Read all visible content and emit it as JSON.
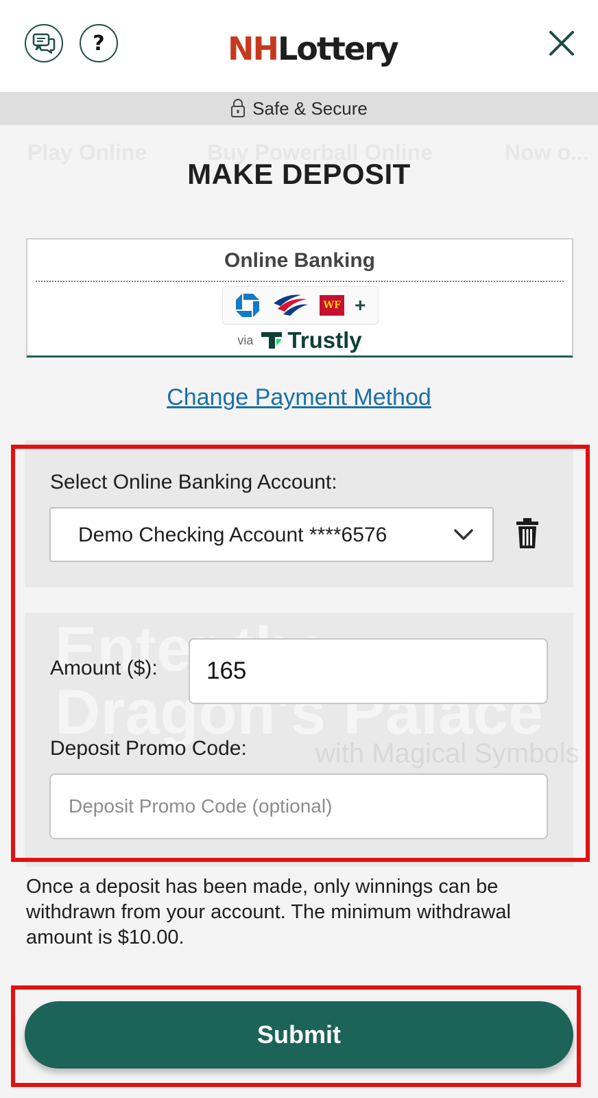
{
  "header": {
    "chat_icon": "chat-bubbles-icon",
    "help_label": "?",
    "logo_part1": "NH",
    "logo_part2": "Lottery",
    "close_icon": "close-icon"
  },
  "secure_bar": {
    "icon": "lock-icon",
    "text": "Safe & Secure"
  },
  "background_text": {
    "row1": [
      "Play Online",
      "Buy Powerball Online",
      "Now o..."
    ],
    "big_line1": "Enter the",
    "big_line2": "Dragon's Palace",
    "mid": "with Magical Symbols"
  },
  "page": {
    "title": "MAKE DEPOSIT"
  },
  "payment_method": {
    "heading": "Online Banking",
    "banks": [
      "chase-icon",
      "bank-of-america-icon",
      "wells-fargo-icon"
    ],
    "wf_label": "WF",
    "plus": "+",
    "via": "via",
    "provider": "Trustly"
  },
  "change_link": "Change Payment Method",
  "account": {
    "label": "Select Online Banking Account:",
    "selected": "Demo Checking Account ****6576",
    "delete_icon": "trash-icon"
  },
  "amount": {
    "label": "Amount ($):",
    "value": "165"
  },
  "promo": {
    "label": "Deposit Promo Code:",
    "placeholder": "Deposit Promo Code (optional)"
  },
  "notice": "Once a deposit has been made, only winnings can be withdrawn from your account. The minimum withdrawal amount is $10.00.",
  "submit_label": "Submit",
  "colors": {
    "brand_green": "#1c6358",
    "logo_red": "#c53a1c",
    "link_blue": "#1a6fa8",
    "highlight_red": "#e41010"
  }
}
